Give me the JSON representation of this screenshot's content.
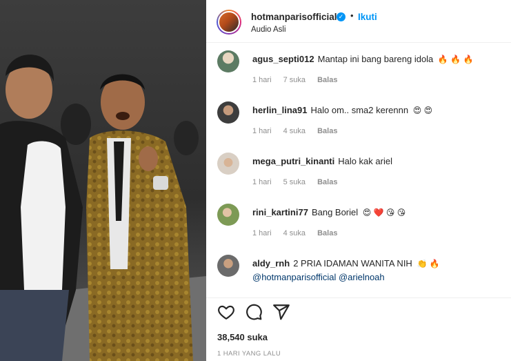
{
  "post": {
    "username": "hotmanparisofficial",
    "follow_label": "Ikuti",
    "separator": "•",
    "audio_label": "Audio Asli",
    "verified_glyph": "✓"
  },
  "comments": [
    {
      "user": "agus_septi012",
      "text": "Mantap ini bang bareng idola",
      "emoji": "🔥 🔥 🔥",
      "time": "1 hari",
      "likes": "7 suka",
      "reply": "Balas",
      "avatar_color": "#5c7b63"
    },
    {
      "user": "herlin_lina91",
      "text": "Halo om.. sma2 kerennn",
      "emoji": "😍 😍",
      "time": "1 hari",
      "likes": "4 suka",
      "reply": "Balas",
      "avatar_color": "#3d3d3d"
    },
    {
      "user": "mega_putri_kinanti",
      "text": "Halo kak ariel",
      "emoji": "",
      "time": "1 hari",
      "likes": "5 suka",
      "reply": "Balas",
      "avatar_color": "#d9cfc4"
    },
    {
      "user": "rini_kartini77",
      "text": "Bang Boriel",
      "emoji": "😍 ❤️ 😘 😘",
      "time": "1 hari",
      "likes": "4 suka",
      "reply": "Balas",
      "avatar_color": "#7d9a55"
    },
    {
      "user": "aldy_rnh",
      "text": "2 PRIA IDAMAN WANITA NIH",
      "emoji": "👏 🔥",
      "mention": "@hotmanparisofficial @arielnoah",
      "avatar_color": "#6b6b6b"
    }
  ],
  "actions": {
    "like_icon": "heart-icon",
    "comment_icon": "comment-icon",
    "share_icon": "share-icon",
    "likes_count": "38,540 suka",
    "posted_time": "1 HARI YANG LALU"
  }
}
